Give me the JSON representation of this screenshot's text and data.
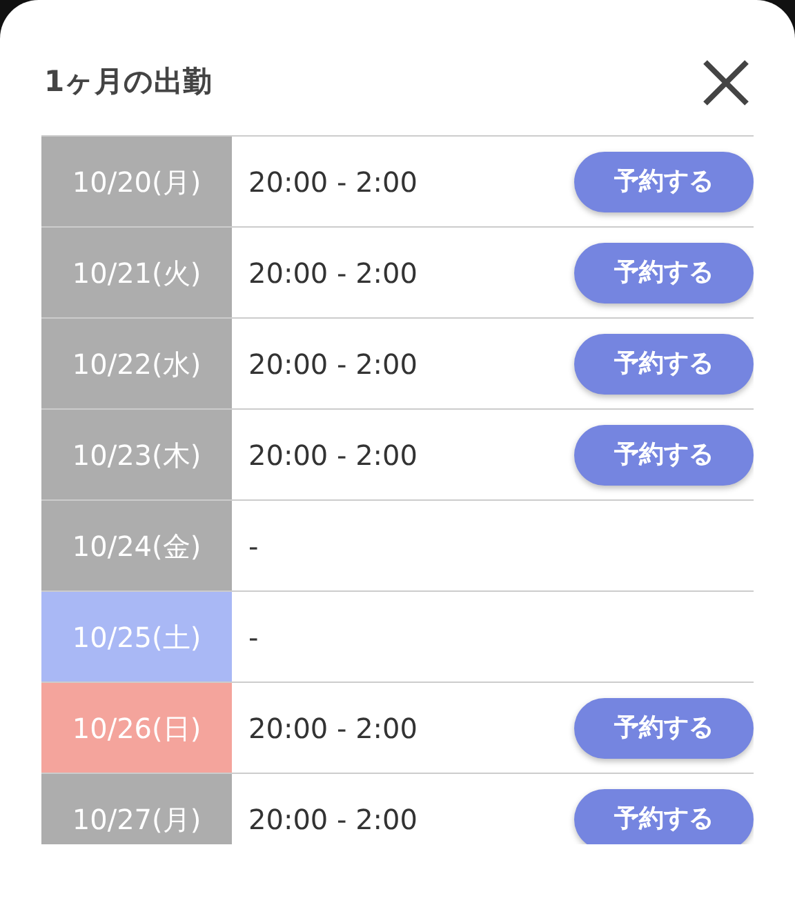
{
  "dialog": {
    "title": "1ヶ月の出勤"
  },
  "rows": [
    {
      "date": "10/20(月)",
      "color": "#adadad",
      "time": "20:00 - 2:00",
      "button": "予約する"
    },
    {
      "date": "10/21(火)",
      "color": "#adadad",
      "time": "20:00 - 2:00",
      "button": "予約する"
    },
    {
      "date": "10/22(水)",
      "color": "#adadad",
      "time": "20:00 - 2:00",
      "button": "予約する"
    },
    {
      "date": "10/23(木)",
      "color": "#adadad",
      "time": "20:00 - 2:00",
      "button": "予約する"
    },
    {
      "date": "10/24(金)",
      "color": "#adadad",
      "time": "-"
    },
    {
      "date": "10/25(土)",
      "color": "#a9b8f5",
      "time": "-"
    },
    {
      "date": "10/26(日)",
      "color": "#f4a49c",
      "time": "20:00 - 2:00",
      "button": "予約する"
    },
    {
      "date": "10/27(月)",
      "color": "#adadad",
      "time": "20:00 - 2:00",
      "button": "予約する"
    }
  ]
}
